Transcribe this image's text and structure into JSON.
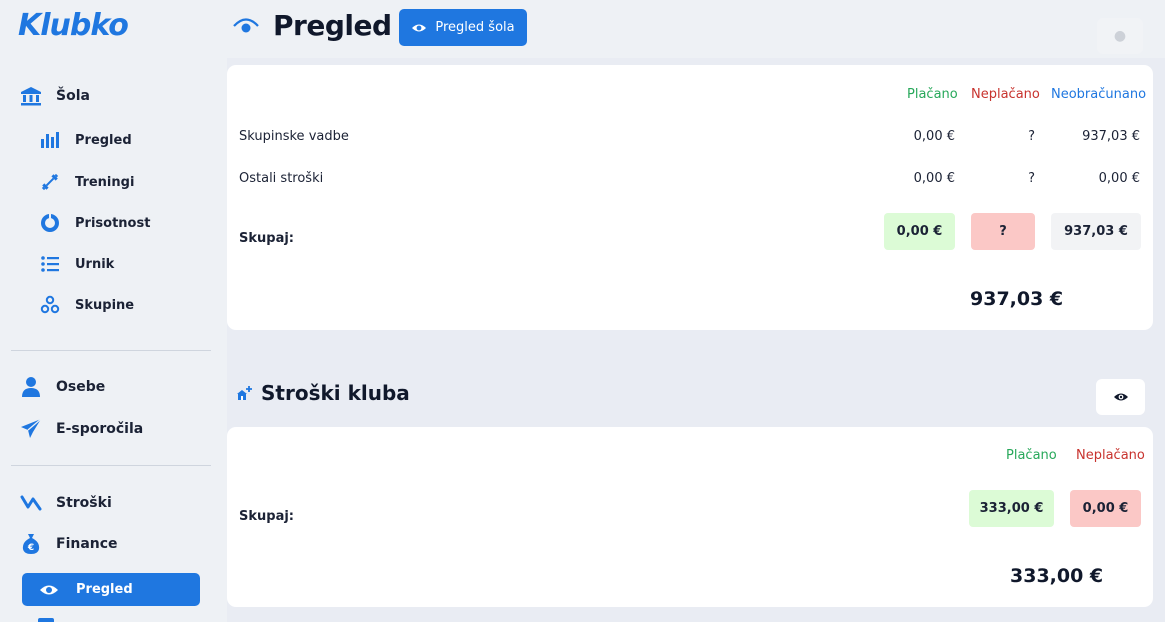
{
  "brand": {
    "logo": "Klubko"
  },
  "sidebar": {
    "school": {
      "label": "Šola"
    },
    "sub_items": [
      {
        "label": "Pregled",
        "icon": "bar-chart-icon"
      },
      {
        "label": "Treningi",
        "icon": "dumbbell-icon"
      },
      {
        "label": "Prisotnost",
        "icon": "donut-chart-icon"
      },
      {
        "label": "Urnik",
        "icon": "list-icon"
      },
      {
        "label": "Skupine",
        "icon": "group-icon"
      }
    ],
    "people": {
      "label": "Osebe"
    },
    "messages": {
      "label": "E-sporočila"
    },
    "costs": {
      "label": "Stroški"
    },
    "finance": {
      "label": "Finance"
    },
    "finance_active": {
      "label": "Pregled"
    }
  },
  "header": {
    "title": "Pregled",
    "button_label": "Pregled šola"
  },
  "school_card": {
    "columns": {
      "paid": "Plačano",
      "unpaid": "Neplačano",
      "unbilled": "Neobračunano"
    },
    "rows": [
      {
        "label": "Skupinske vadbe",
        "paid": "0,00 €",
        "unpaid": "?",
        "unbilled": "937,03 €"
      },
      {
        "label": "Ostali stroški",
        "paid": "0,00 €",
        "unpaid": "?",
        "unbilled": "0,00 €"
      }
    ],
    "total": {
      "label": "Skupaj:",
      "paid": "0,00 €",
      "unpaid": "?",
      "unbilled": "937,03 €"
    },
    "grand_total": "937,03 €"
  },
  "club_costs": {
    "title": "Stroški kluba",
    "columns": {
      "paid": "Plačano",
      "unpaid": "Neplačano"
    },
    "total": {
      "label": "Skupaj:",
      "paid": "333,00 €",
      "unpaid": "0,00 €"
    },
    "grand_total": "333,00 €"
  },
  "colors": {
    "accent": "#1f77e0",
    "paid": "#27a85a",
    "unpaid": "#c8332e"
  }
}
